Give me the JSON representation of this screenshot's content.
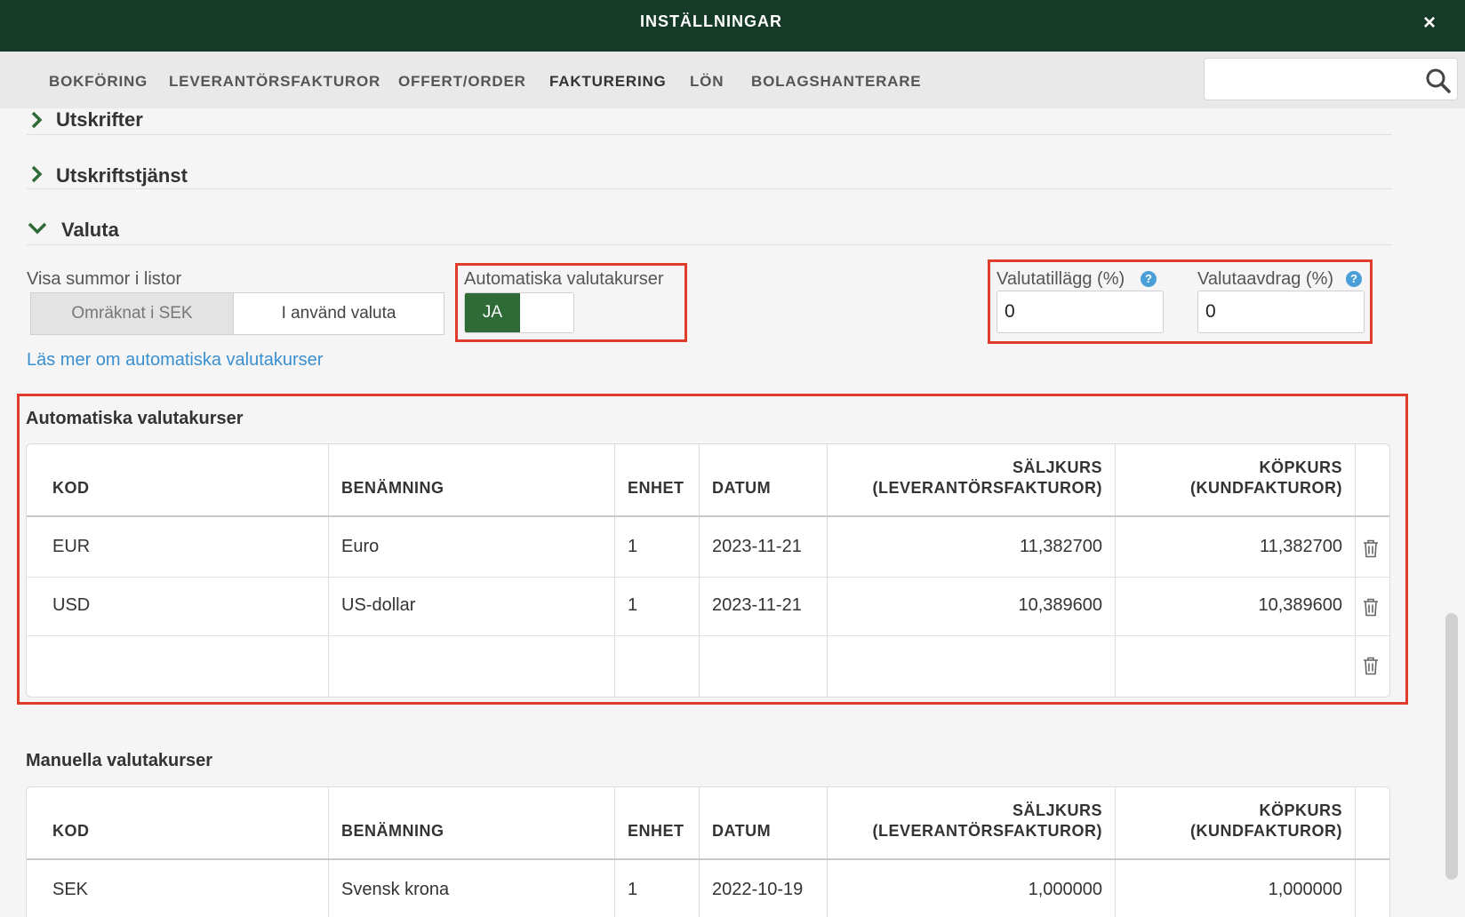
{
  "header": {
    "title": "INSTÄLLNINGAR",
    "close_label": "×"
  },
  "nav": {
    "tabs": [
      {
        "label": "BOKFÖRING"
      },
      {
        "label": "LEVERANTÖRSFAKTUROR"
      },
      {
        "label": "OFFERT/ORDER"
      },
      {
        "label": "FAKTURERING"
      },
      {
        "label": "LÖN"
      },
      {
        "label": "BOLAGSHANTERARE"
      }
    ],
    "active_tab": "FAKTURERING",
    "search": {
      "value": "",
      "placeholder": ""
    }
  },
  "sections": [
    {
      "label": "Utskrifter",
      "expanded": false
    },
    {
      "label": "Utskriftstjänst",
      "expanded": false
    },
    {
      "label": "Valuta",
      "expanded": true
    }
  ],
  "valuta": {
    "show_sums_label": "Visa summor i listor",
    "show_sums_options": [
      "Omräknat i SEK",
      "I använd valuta"
    ],
    "show_sums_selected": "I använd valuta",
    "auto_rates_label": "Automatiska valutakurser",
    "auto_rates_toggle": "JA",
    "surcharge_label": "Valutatillägg (%)",
    "surcharge_value": "0",
    "deduction_label": "Valutaavdrag (%)",
    "deduction_value": "0",
    "help_icon": "?",
    "read_more_link": "Läs mer om automatiska valutakurser"
  },
  "columns": {
    "kod": "KOD",
    "benamning": "BENÄMNING",
    "enhet": "ENHET",
    "datum": "DATUM",
    "saljkurs_1": "SÄLJKURS",
    "saljkurs_2": "(LEVERANTÖRSFAKTUROR)",
    "kopkurs_1": "KÖPKURS",
    "kopkurs_2": "(KUNDFAKTUROR)"
  },
  "auto_table": {
    "title": "Automatiska valutakurser",
    "rows": [
      {
        "kod": "EUR",
        "benamning": "Euro",
        "enhet": "1",
        "datum": "2023-11-21",
        "saljkurs": "11,382700",
        "kopkurs": "11,382700"
      },
      {
        "kod": "USD",
        "benamning": "US-dollar",
        "enhet": "1",
        "datum": "2023-11-21",
        "saljkurs": "10,389600",
        "kopkurs": "10,389600"
      },
      {
        "kod": "",
        "benamning": "",
        "enhet": "",
        "datum": "",
        "saljkurs": "",
        "kopkurs": ""
      }
    ]
  },
  "manual_table": {
    "title": "Manuella valutakurser",
    "rows": [
      {
        "kod": "SEK",
        "benamning": "Svensk krona",
        "enhet": "1",
        "datum": "2022-10-19",
        "saljkurs": "1,000000",
        "kopkurs": "1,000000"
      }
    ]
  },
  "colors": {
    "header_bg": "#163a28",
    "accent_green": "#2e6b37",
    "highlight_red": "#e03c2a",
    "link_blue": "#3a8fd0"
  }
}
